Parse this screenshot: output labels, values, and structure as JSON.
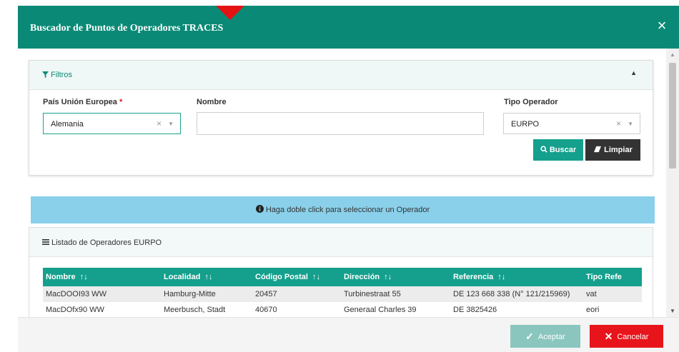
{
  "modal": {
    "title": "Buscador de Puntos de Operadores TRACES",
    "close_icon": "×"
  },
  "filters": {
    "title": "Filtros",
    "collapse_icon": "▲",
    "pais": {
      "label": "País Unión Europea",
      "required": "*",
      "value": "Alemania",
      "clear": "×",
      "dropdown": "▼"
    },
    "nombre": {
      "label": "Nombre",
      "value": ""
    },
    "tipo": {
      "label": "Tipo Operador",
      "value": "EURPO",
      "clear": "×",
      "dropdown": "▼"
    },
    "buscar_label": "Buscar",
    "limpiar_label": "Limpiar"
  },
  "info": {
    "text": "Haga doble click para seleccionar un Operador"
  },
  "list": {
    "title": "Listado de Operadores EURPO",
    "columns": [
      "Nombre",
      "Localidad",
      "Código Postal",
      "Dirección",
      "Referencia",
      "Tipo Refe"
    ],
    "sort_icon": "↑↓",
    "rows": [
      [
        "MacDOOI93 WW",
        "Hamburg-Mitte",
        "20457",
        "Turbinestraat 55",
        "DE 123 668 338 (N° 121/215969)",
        "vat"
      ],
      [
        "MacDOfx90 WW",
        "Meerbusch, Stadt",
        "40670",
        "Generaal Charles 39",
        "DE 3825426",
        "eori"
      ]
    ]
  },
  "footer": {
    "aceptar_label": "Aceptar",
    "cancelar_label": "Cancelar"
  },
  "colors": {
    "header": "#0a8a76",
    "table_header": "#14a08c",
    "info_bar": "#8ad0ea",
    "cancel": "#e8141b"
  }
}
